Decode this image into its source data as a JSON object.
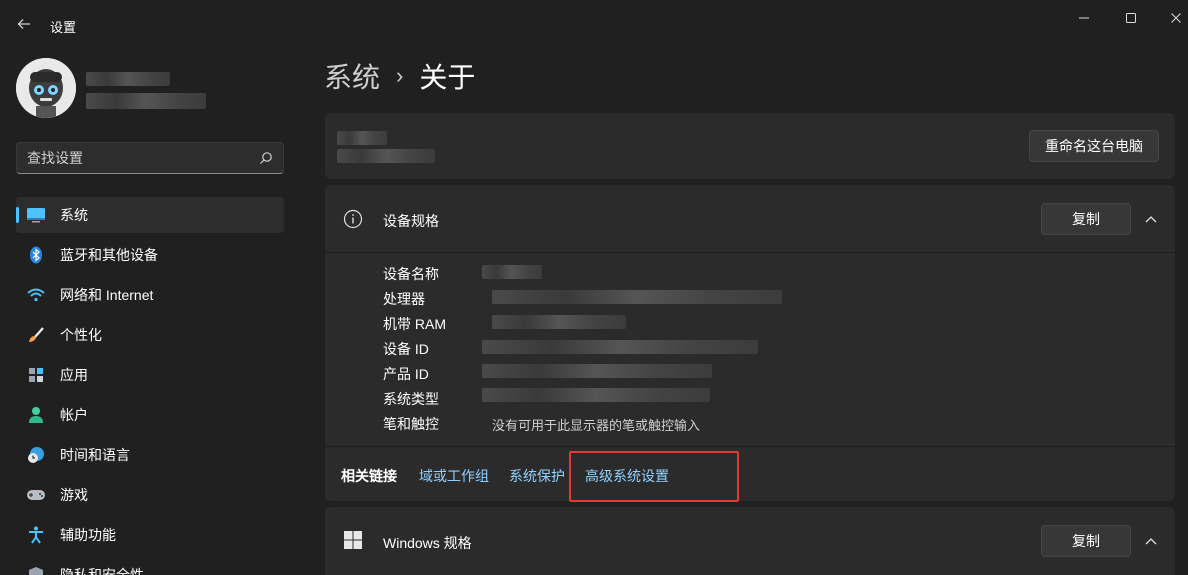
{
  "window": {
    "title": "设置",
    "back_icon": "back-arrow-icon",
    "controls": [
      "minimize-icon",
      "maximize-icon",
      "close-icon"
    ]
  },
  "sidebar": {
    "search_placeholder": "查找设置",
    "items": [
      {
        "label": "系统",
        "icon": "system-icon",
        "active": true
      },
      {
        "label": "蓝牙和其他设备",
        "icon": "bluetooth-icon"
      },
      {
        "label": "网络和 Internet",
        "icon": "wifi-icon"
      },
      {
        "label": "个性化",
        "icon": "brush-icon"
      },
      {
        "label": "应用",
        "icon": "apps-icon"
      },
      {
        "label": "帐户",
        "icon": "account-icon"
      },
      {
        "label": "时间和语言",
        "icon": "clock-globe-icon"
      },
      {
        "label": "游戏",
        "icon": "gamepad-icon"
      },
      {
        "label": "辅助功能",
        "icon": "accessibility-icon"
      },
      {
        "label": "隐私和安全性",
        "icon": "shield-icon"
      }
    ]
  },
  "main": {
    "breadcrumb": {
      "parent": "系统",
      "separator": "›",
      "current": "关于"
    },
    "device_card": {
      "rename_button": "重命名这台电脑"
    },
    "device_specs": {
      "title": "设备规格",
      "copy_button": "复制",
      "rows": [
        {
          "label": "设备名称",
          "value": ""
        },
        {
          "label": "处理器",
          "value": ""
        },
        {
          "label": "机带 RAM",
          "value": ""
        },
        {
          "label": "设备 ID",
          "value": ""
        },
        {
          "label": "产品 ID",
          "value": ""
        },
        {
          "label": "系统类型",
          "value": ""
        },
        {
          "label": "笔和触控",
          "value": "没有可用于此显示器的笔或触控输入"
        }
      ]
    },
    "related_links": {
      "label": "相关链接",
      "links": [
        "域或工作组",
        "系统保护",
        "高级系统设置"
      ]
    },
    "windows_specs": {
      "title": "Windows 规格",
      "copy_button": "复制"
    }
  },
  "colors": {
    "accent": "#4cc2ff",
    "link": "#8fd1ff",
    "highlight_box": "#e53935",
    "background": "#202020",
    "card": "#2b2b2b"
  }
}
